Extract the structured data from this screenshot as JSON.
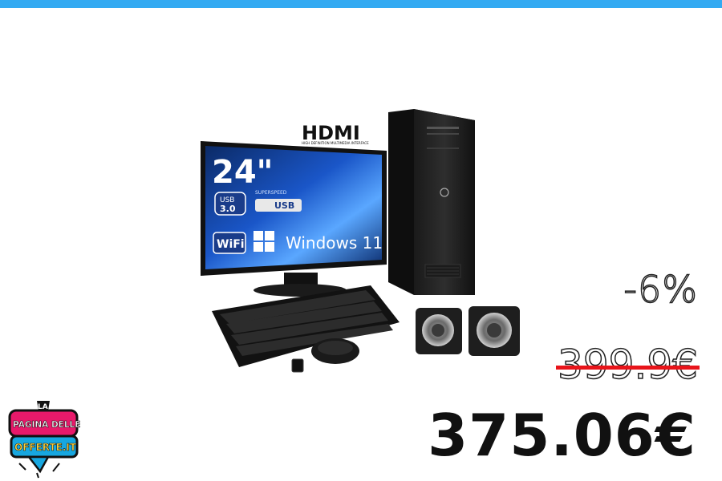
{
  "header": {
    "accent_color": "#33aaf2"
  },
  "product": {
    "image_label": "desktop-pc-bundle",
    "screen_size": "24\"",
    "usb_badge": "USB 3.0",
    "superspeed_text": "SUPERSPEED",
    "superspeed_usb": "USB",
    "wifi_text": "WiFi",
    "os_text": "Windows 11",
    "hdmi_text": "HDMI",
    "hdmi_tagline": "HIGH DEFINITION MULTIMEDIA INTERFACE"
  },
  "pricing": {
    "discount": "-6%",
    "old_price": "399.9€",
    "new_price": "375.06€",
    "strike_color": "#e8141a"
  },
  "logo": {
    "line1": "LA",
    "line2": "PAGINA DELLE",
    "line3": "OFFERTE.IT",
    "brand_color": "#e8196a",
    "accent_color": "#17a7e0"
  }
}
